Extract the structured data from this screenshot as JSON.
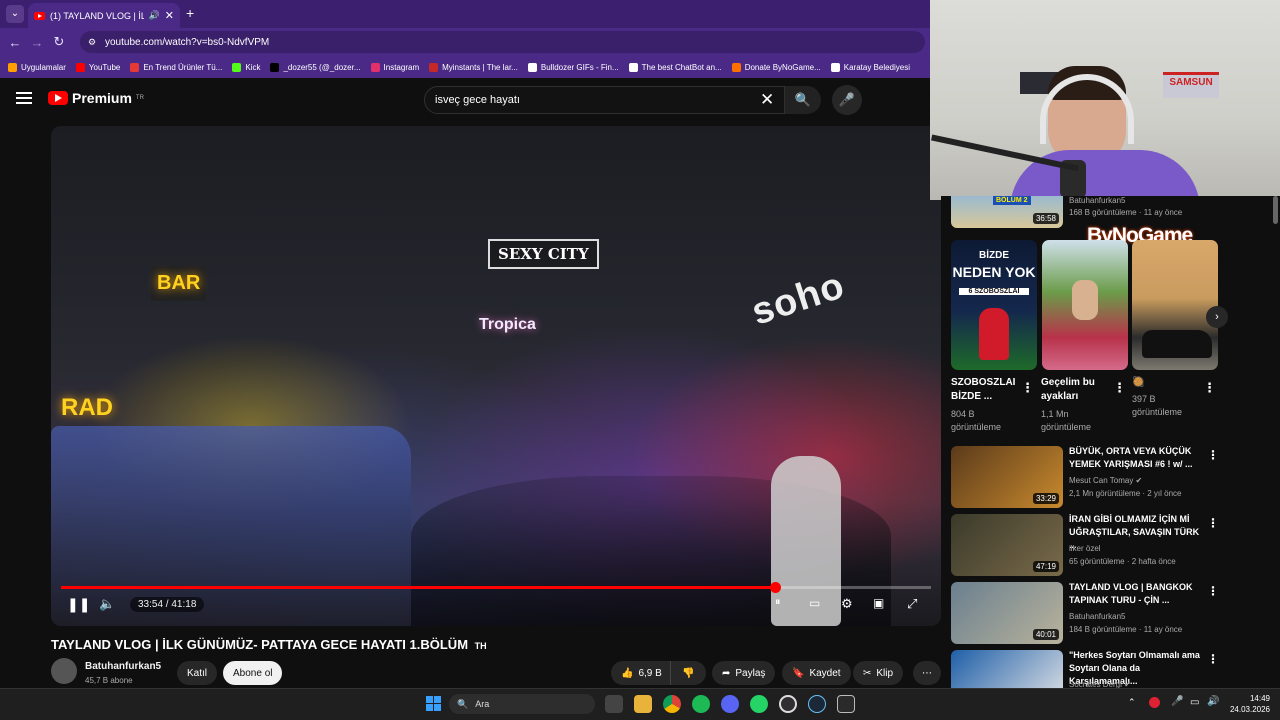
{
  "browser": {
    "tab_title": "(1) TAYLAND VLOG | İLK GÜ",
    "url": "youtube.com/watch?v=bs0-NdvfVPM",
    "bookmarks": [
      {
        "label": "Uygulamalar",
        "color": "#ffa000"
      },
      {
        "label": "YouTube",
        "color": "#ff0000"
      },
      {
        "label": "En Trend Ürünler Tü...",
        "color": "#e53935"
      },
      {
        "label": "Kick",
        "color": "#53fc18"
      },
      {
        "label": "_dozer55 (@_dozer...",
        "color": "#000000"
      },
      {
        "label": "Instagram",
        "color": "#e1306c"
      },
      {
        "label": "Myinstants | The lar...",
        "color": "#c62828"
      },
      {
        "label": "Bulldozer GIFs - Fin...",
        "color": "#ffffff"
      },
      {
        "label": "The best ChatBot an...",
        "color": "#ffffff"
      },
      {
        "label": "Donate ByNoGame...",
        "color": "#ff6f00"
      },
      {
        "label": "Karatay Belediyesi",
        "color": "#ffffff"
      }
    ]
  },
  "header": {
    "logo_text": "Premium",
    "logo_sup": "TR",
    "search_value": "isveç gece hayatı"
  },
  "player": {
    "current_time": "33:54",
    "duration": "41:18",
    "progress": 0.821,
    "signs": [
      "SEXY CITY",
      "Tropica",
      "soho",
      "RAD",
      "BAR"
    ]
  },
  "video": {
    "title": "TAYLAND VLOG | İLK GÜNÜMÜZ- PATTAYA GECE HAYATI 1.BÖLÜM",
    "title_suffix": "TH",
    "channel": "Batuhanfurkan5",
    "subscribers": "45,7 B abone",
    "join_label": "Katıl",
    "subscribe_label": "Abone ol",
    "likes": "6,9 B",
    "share_label": "Paylaş",
    "save_label": "Kaydet",
    "clip_label": "Klip"
  },
  "webcam": {
    "sign1": "SAMSUN",
    "watermark": "ByNoGame"
  },
  "sidebar": {
    "top_item": {
      "duration": "36:58",
      "channel": "Batuhanfurkan5",
      "meta": "168 B görüntüleme · 11 ay önce",
      "badge": "BÖLÜM 2"
    },
    "shorts": [
      {
        "title": "SZOBOSZLAI BİZDE ...",
        "views": "804 B görüntüleme",
        "overlay_top": "BİZDE",
        "overlay_big": "NEDEN YOK",
        "overlay_small": "6 SZOBOSZLAI"
      },
      {
        "title": "Geçelim bu ayakları",
        "views": "1,1 Mn görüntüleme"
      },
      {
        "title": "🥘",
        "views": "397 B görüntüleme"
      }
    ],
    "videos": [
      {
        "title": "BÜYÜK, ORTA VEYA KÜÇÜK YEMEK YARIŞMASI #6 ! w/ ...",
        "channel": "Mesut Can Tomay",
        "verified": true,
        "meta": "2,1 Mn görüntüleme · 2 yıl önce",
        "duration": "33:29",
        "thumb": [
          "#5b3a1a",
          "#c88a2e"
        ]
      },
      {
        "title": "İRAN GİBİ OLMAMIZ İÇİN Mİ UĞRAŞTILAR, SAVAŞIN TÜRK ...",
        "channel": "ilker özel",
        "verified": false,
        "meta": "65 görüntüleme · 2 hafta önce",
        "duration": "47:19",
        "thumb": [
          "#3a3a2a",
          "#7a6a4a"
        ]
      },
      {
        "title": "TAYLAND VLOG | BANGKOK TAPINAK TURU - ÇİN ...",
        "channel": "Batuhanfurkan5",
        "verified": false,
        "meta": "184 B görüntüleme · 11 ay önce",
        "duration": "40:01",
        "thumb": [
          "#6a7f8f",
          "#b9b39c"
        ]
      },
      {
        "title": "\"Herkes Soytarı Olmamalı ama Soytarı Olana da Karşılamamalı...",
        "channel": "Socrates Dergi",
        "verified": true,
        "meta": "",
        "duration": "",
        "thumb": [
          "#1f5fa8",
          "#e8e8e8"
        ]
      }
    ]
  },
  "taskbar": {
    "search_placeholder": "Ara",
    "time": "14:49",
    "date": "24.03.2026"
  }
}
